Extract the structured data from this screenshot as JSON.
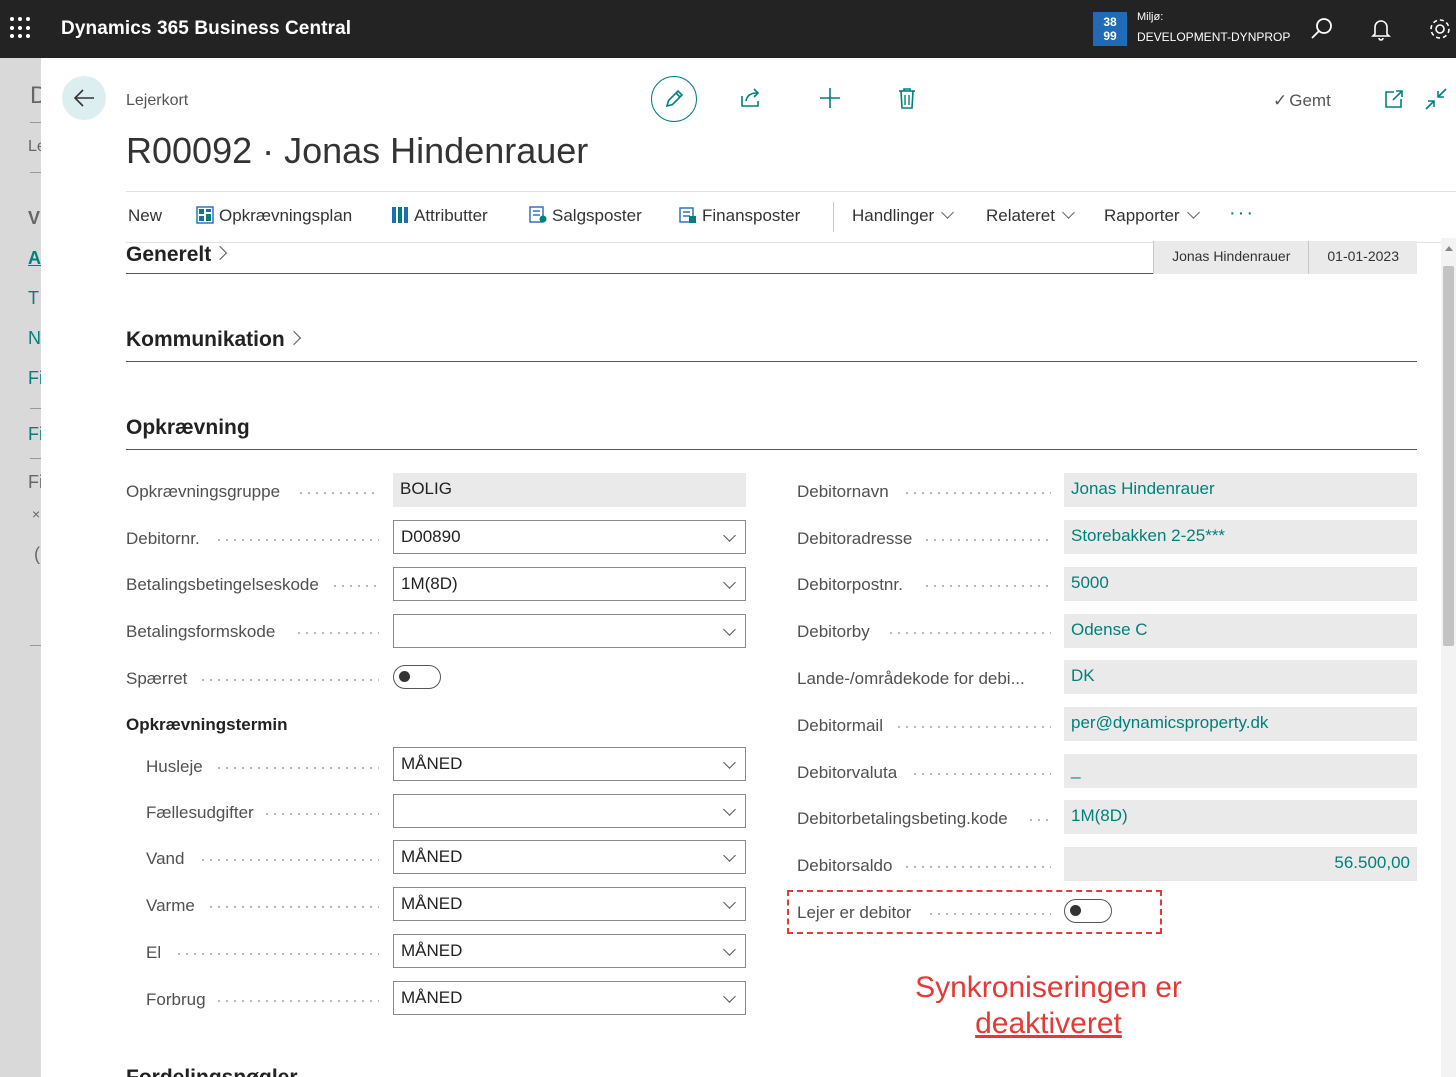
{
  "topbar": {
    "app_title": "Dynamics 365 Business Central",
    "env_badge_top": "38",
    "env_badge_bottom": "99",
    "env_label": "Miljø:",
    "env_name": "DEVELOPMENT-DYNPROP"
  },
  "background_page": {
    "letters": [
      "D",
      "Le",
      "V",
      "A",
      "T",
      "N",
      "Fi",
      "Fi",
      "Fi",
      "×",
      "("
    ]
  },
  "header": {
    "breadcrumb": "Lejerkort",
    "record_title": "R00092 · Jonas Hindenrauer",
    "saved_label": "Gemt"
  },
  "actions": {
    "new": "New",
    "opkraevningsplan": "Opkrævningsplan",
    "attributter": "Attributter",
    "salgsposter": "Salgsposter",
    "finansposter": "Finansposter",
    "handlinger": "Handlinger",
    "relateret": "Relateret",
    "rapporter": "Rapporter",
    "more": "···"
  },
  "sections": {
    "generelt": {
      "title": "Generelt",
      "name_pill": "Jonas Hindenrauer",
      "date_pill": "01-01-2023"
    },
    "kommunikation": {
      "title": "Kommunikation"
    },
    "opkraevning": {
      "title": "Opkrævning"
    }
  },
  "left_fields": [
    {
      "label": "Opkrævningsgruppe",
      "value": "BOLIG"
    },
    {
      "label": "Debitornr.",
      "value": "D00890"
    },
    {
      "label": "Betalingsbetingelseskode",
      "value": "1M(8D)"
    },
    {
      "label": "Betalingsformskode",
      "value": ""
    },
    {
      "label": "Spærret"
    }
  ],
  "termin": {
    "heading": "Opkrævningstermin",
    "fields": [
      {
        "label": "Husleje",
        "value": "MÅNED"
      },
      {
        "label": "Fællesudgifter",
        "value": ""
      },
      {
        "label": "Vand",
        "value": "MÅNED"
      },
      {
        "label": "Varme",
        "value": "MÅNED"
      },
      {
        "label": "El",
        "value": "MÅNED"
      },
      {
        "label": "Forbrug",
        "value": "MÅNED"
      }
    ]
  },
  "right_fields": [
    {
      "label": "Debitornavn",
      "value": "Jonas Hindenrauer"
    },
    {
      "label": "Debitoradresse",
      "value": "Storebakken 2-25***"
    },
    {
      "label": "Debitorpostnr.",
      "value": "5000"
    },
    {
      "label": "Debitorby",
      "value": "Odense C"
    },
    {
      "label": "Lande-/områdekode for debi...",
      "value": "DK"
    },
    {
      "label": "Debitormail",
      "value": "per@dynamicsproperty.dk"
    },
    {
      "label": "Debitorvaluta",
      "value": "_"
    },
    {
      "label": "Debitorbetalingsbeting.kode",
      "value": "1M(8D)"
    },
    {
      "label": "Debitorsaldo",
      "value": "56.500,00"
    },
    {
      "label": "Lejer er debitor"
    }
  ],
  "annotation": {
    "line1": "Synkroniseringen er",
    "line2": "deaktiveret",
    "color": "#e53935"
  },
  "next_section_peek": "Fordelingsnøgler",
  "colors": {
    "accent": "#00807b",
    "topbar": "#232323",
    "badge": "#1f6bb5"
  }
}
